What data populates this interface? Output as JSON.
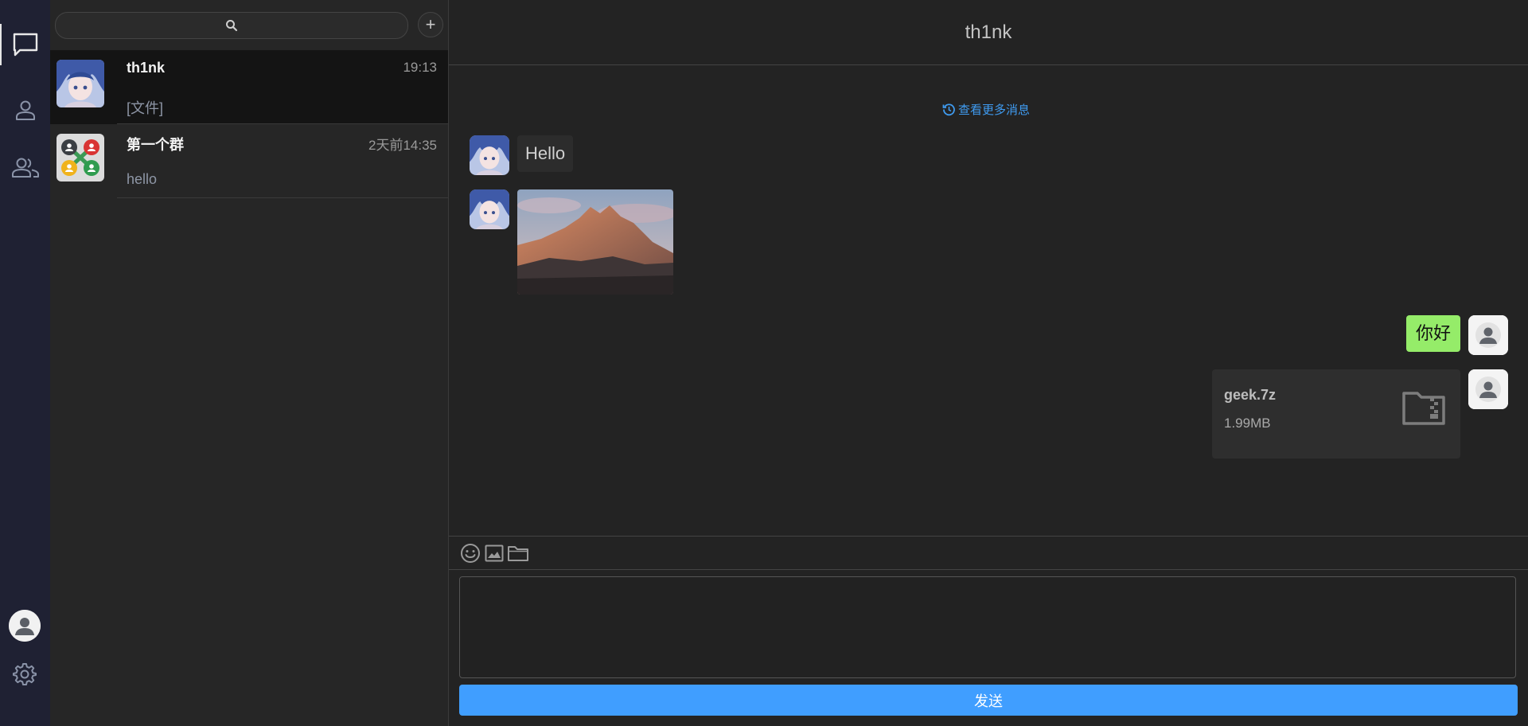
{
  "search": {
    "placeholder": ""
  },
  "add_button": {
    "label": "+"
  },
  "conversations": [
    {
      "name": "th1nk",
      "time": "19:13",
      "preview": "[文件]",
      "active": true
    },
    {
      "name": "第一个群",
      "time": "2天前14:35",
      "preview": "hello",
      "active": false
    }
  ],
  "chat": {
    "title": "th1nk",
    "load_more": "查看更多消息",
    "messages": [
      {
        "from": "other",
        "type": "text",
        "text": "Hello"
      },
      {
        "from": "other",
        "type": "image"
      },
      {
        "from": "me",
        "type": "text",
        "text": "你好"
      },
      {
        "from": "me",
        "type": "file",
        "file_name": "geek.7z",
        "file_size": "1.99MB"
      }
    ]
  },
  "composer": {
    "value": "",
    "send_label": "发送"
  },
  "icons": {
    "rail": [
      "chat-icon",
      "contact-icon",
      "group-icon",
      "avatar",
      "gear-icon"
    ],
    "toolbar": [
      "emoji-icon",
      "image-icon",
      "folder-icon"
    ]
  },
  "colors": {
    "rail_bg": "#1f2133",
    "list_bg": "#262626",
    "chat_bg": "#232323",
    "accent": "#409eff",
    "my_bubble": "#95ec69",
    "link": "#3f9bf0"
  }
}
